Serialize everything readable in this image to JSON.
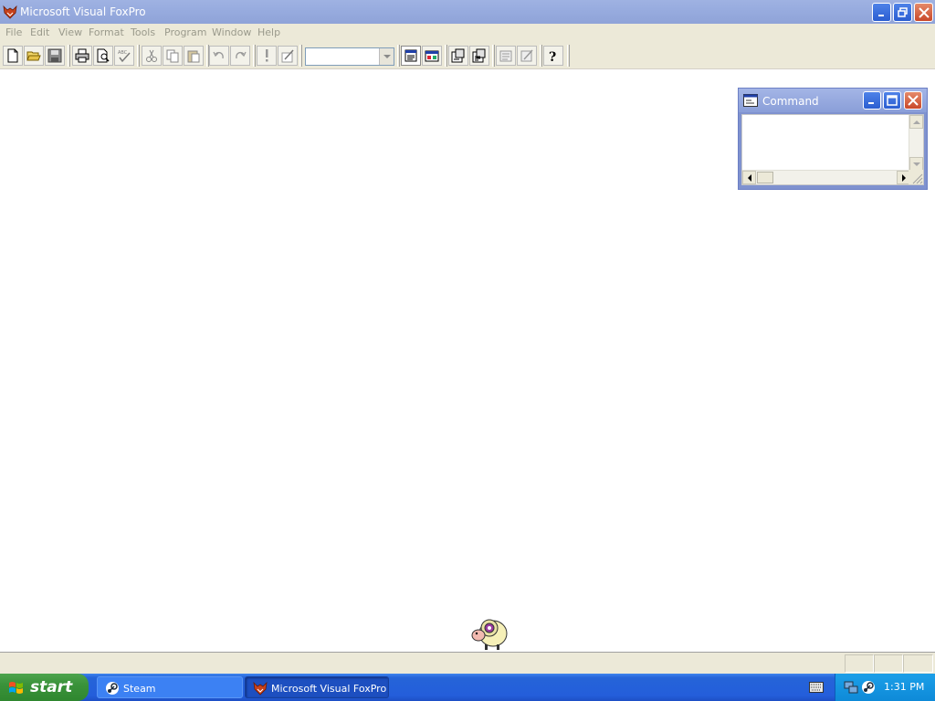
{
  "window": {
    "title": "Microsoft Visual FoxPro",
    "icon": "foxpro-icon",
    "controls": [
      "minimize-icon",
      "restore-icon",
      "close-icon"
    ]
  },
  "menubar": {
    "items": [
      "File",
      "Edit",
      "View",
      "Format",
      "Tools",
      "Program",
      "Window",
      "Help"
    ]
  },
  "toolbar": {
    "buttons": [
      "new-file-icon",
      "open-folder-icon",
      "save-icon",
      "print-icon",
      "print-preview-icon",
      "spell-check-icon",
      "cut-icon",
      "copy-icon",
      "paste-icon",
      "undo-icon",
      "redo-icon",
      "run-icon",
      "modify-form-icon",
      "command-window-icon",
      "view-window-icon",
      "form-designer-icon",
      "report-designer-icon",
      "form-wizard-icon",
      "report-wizard-icon",
      "help-icon"
    ],
    "combo_value": ""
  },
  "command_window": {
    "title": "Command",
    "icon": "command-window-icon",
    "content": ""
  },
  "statusbar": {
    "text": ""
  },
  "taskbar": {
    "start_label": "start",
    "tasks": [
      {
        "label": "Steam",
        "icon": "steam-icon"
      },
      {
        "label": "Microsoft Visual FoxPro",
        "icon": "foxpro-icon"
      }
    ],
    "tray_icons": [
      "network-icon",
      "steam-icon"
    ],
    "clock": "1:31 PM"
  },
  "colors": {
    "titlebar": "#98acdf",
    "menubar_bg": "#ece9d8",
    "disabled_menu_text": "#9a9a8c",
    "taskbar": "#245edb",
    "start_button": "#3a923a",
    "tray": "#0e8ad8"
  }
}
